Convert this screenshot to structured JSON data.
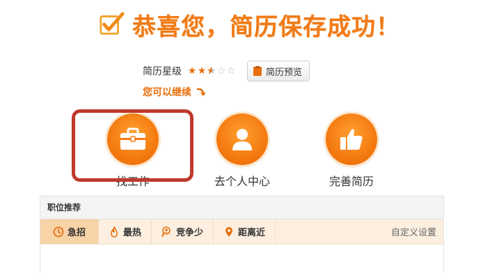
{
  "banner": {
    "title": "恭喜您，简历保存成功！"
  },
  "rating": {
    "label": "简历星级",
    "stars_filled": 2.5,
    "stars_total": 5
  },
  "preview_button": {
    "label": "简历预览"
  },
  "continue": {
    "text": "您可以继续"
  },
  "actions": [
    {
      "label": "找工作",
      "icon": "briefcase-icon"
    },
    {
      "label": "去个人中心",
      "icon": "person-icon"
    },
    {
      "label": "完善简历",
      "icon": "thumbs-up-icon"
    }
  ],
  "panel": {
    "title": "职位推荐",
    "tabs": [
      {
        "label": "急招",
        "icon": "clock-icon"
      },
      {
        "label": "最热",
        "icon": "flame-icon"
      },
      {
        "label": "竞争少",
        "icon": "search-person-icon"
      },
      {
        "label": "距离近",
        "icon": "location-pin-icon"
      }
    ],
    "custom_settings": "自定义设置"
  },
  "colors": {
    "accent": "#f07a15",
    "highlight": "#c0392b",
    "tab_bg": "#fcefe0"
  }
}
